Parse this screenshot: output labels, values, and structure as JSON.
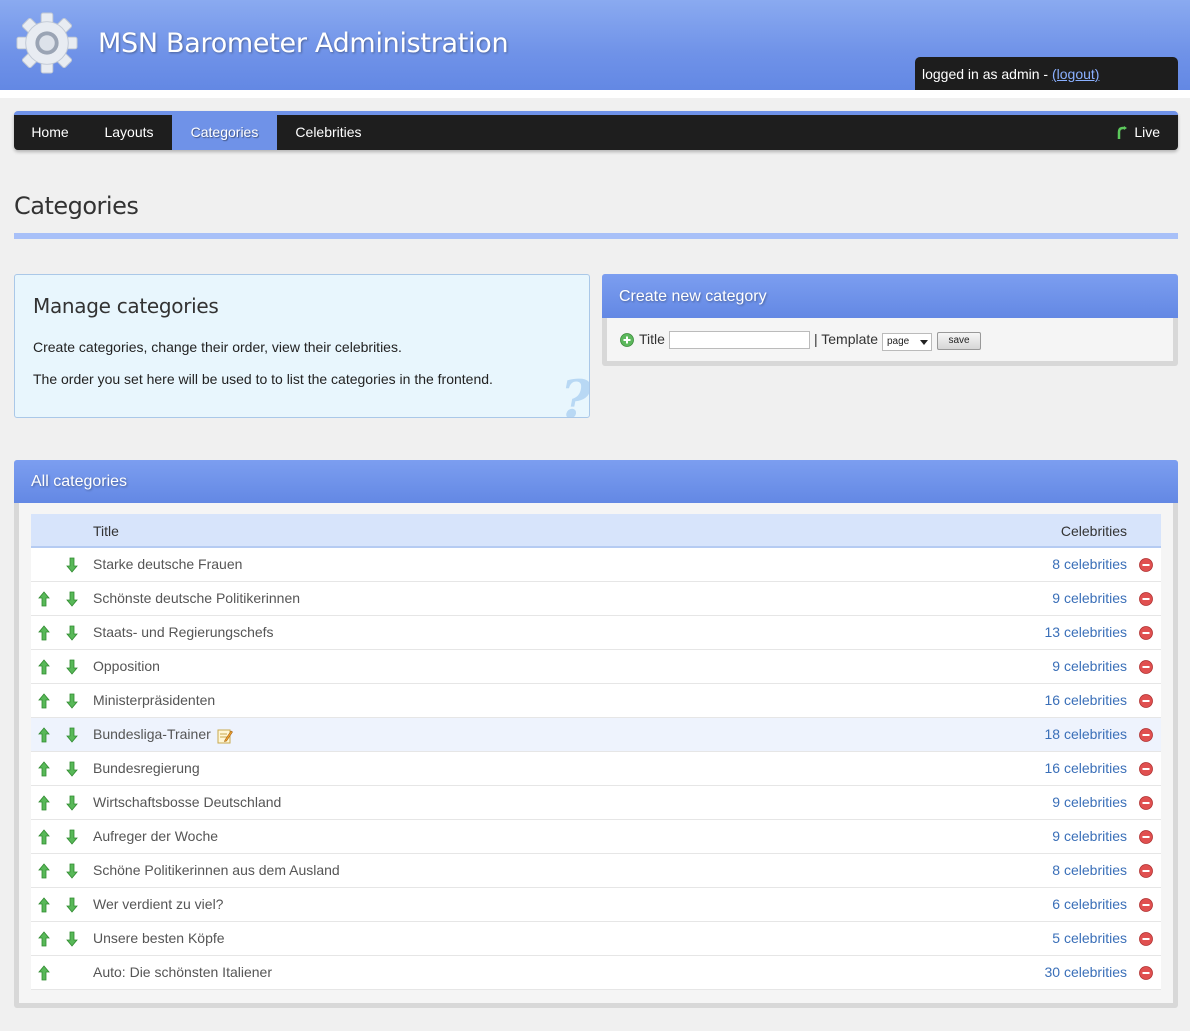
{
  "header": {
    "app_title": "MSN Barometer Administration",
    "login_text": "logged in as admin - ",
    "logout_label": "(logout)"
  },
  "nav": {
    "items": [
      {
        "label": "Home"
      },
      {
        "label": "Layouts"
      },
      {
        "label": "Categories",
        "active": true
      },
      {
        "label": "Celebrities"
      }
    ],
    "live_label": "Live"
  },
  "page_title": "Categories",
  "manage": {
    "title": "Manage categories",
    "p1": "Create categories, change their order, view their celebrities.",
    "p2": "The order you set here will be used to to list the categories in the frontend.",
    "help_glyph": "?"
  },
  "create": {
    "header": "Create new category",
    "title_label": "Title",
    "title_value": "",
    "template_label": "| Template",
    "template_selected": "page",
    "save_label": "save"
  },
  "categories": {
    "header": "All categories",
    "col_title": "Title",
    "col_celebrities": "Celebrities",
    "rows": [
      {
        "title": "Starke deutsche Frauen",
        "count": "8 celebrities"
      },
      {
        "title": "Schönste deutsche Politikerinnen",
        "count": "9 celebrities"
      },
      {
        "title": "Staats- und Regierungschefs",
        "count": "13 celebrities"
      },
      {
        "title": "Opposition",
        "count": "9 celebrities"
      },
      {
        "title": "Ministerpräsidenten",
        "count": "16 celebrities"
      },
      {
        "title": "Bundesliga-Trainer",
        "count": "18 celebrities"
      },
      {
        "title": "Bundesregierung",
        "count": "16 celebrities"
      },
      {
        "title": "Wirtschaftsbosse Deutschland",
        "count": "9 celebrities"
      },
      {
        "title": "Aufreger der Woche",
        "count": "9 celebrities"
      },
      {
        "title": "Schöne Politikerinnen aus dem Ausland",
        "count": "8 celebrities"
      },
      {
        "title": "Wer verdient zu viel?",
        "count": "6 celebrities"
      },
      {
        "title": "Unsere besten Köpfe",
        "count": "5 celebrities"
      },
      {
        "title": "Auto: Die schönsten Italiener",
        "count": "30 celebrities"
      }
    ]
  },
  "colors": {
    "accent": "#6f92e8",
    "nav_bg": "#1e1e1e",
    "link": "#3a6fb8",
    "arrow_green": "#3a9a3a",
    "delete_red": "#d94040"
  },
  "icons": {
    "logo": "gear-icon",
    "live": "phone-icon",
    "add": "plus-icon",
    "move_up": "arrow-up-icon",
    "move_down": "arrow-down-icon",
    "edit": "pencil-icon",
    "delete": "minus-circle-icon"
  }
}
